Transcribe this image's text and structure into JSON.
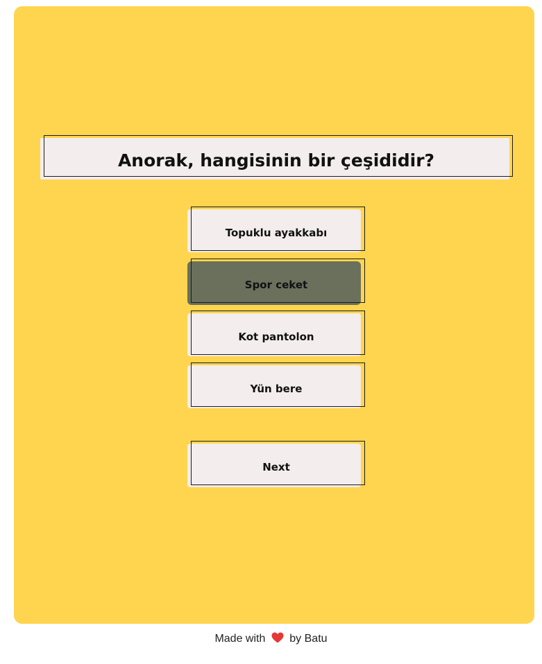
{
  "quiz": {
    "question": "Anorak, hangisinin bir çeşididir?",
    "options": [
      {
        "label": "Topuklu ayakkabı",
        "selected": false
      },
      {
        "label": "Spor ceket",
        "selected": true
      },
      {
        "label": "Kot pantolon",
        "selected": false
      },
      {
        "label": "Yün bere",
        "selected": false
      }
    ],
    "next_label": "Next"
  },
  "footer": {
    "made_with": "Made with",
    "by": "by Batu",
    "heart_icon": "heart-icon"
  },
  "colors": {
    "card_background": "#ffd54f",
    "button_fill": "#f3eded",
    "selected_fill": "#6b705c",
    "heart": "#e53935"
  }
}
